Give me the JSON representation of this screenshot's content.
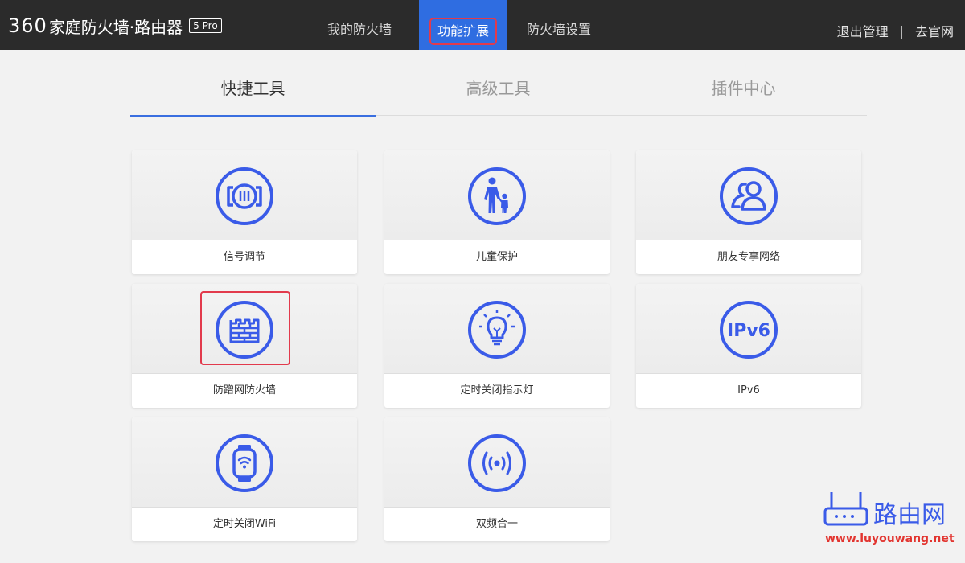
{
  "header": {
    "logo_number": "360",
    "logo_text": "家庭防火墙·路由器",
    "logo_badge": "5 Pro",
    "nav": [
      {
        "label": "我的防火墙",
        "active": false
      },
      {
        "label": "功能扩展",
        "active": true
      },
      {
        "label": "防火墙设置",
        "active": false
      }
    ],
    "logout_label": "退出管理",
    "separator": "|",
    "website_label": "去官网"
  },
  "tabs": [
    {
      "label": "快捷工具",
      "active": true
    },
    {
      "label": "高级工具",
      "active": false
    },
    {
      "label": "插件中心",
      "active": false
    }
  ],
  "tools": [
    {
      "label": "信号调节",
      "icon": "signal-adjust-icon"
    },
    {
      "label": "儿童保护",
      "icon": "child-protection-icon"
    },
    {
      "label": "朋友专享网络",
      "icon": "friends-network-icon"
    },
    {
      "label": "防蹭网防火墙",
      "icon": "firewall-wall-icon",
      "highlighted": true
    },
    {
      "label": "定时关闭指示灯",
      "icon": "light-bulb-icon"
    },
    {
      "label": "IPv6",
      "icon": "ipv6-icon",
      "icon_text": "IPv6"
    },
    {
      "label": "定时关闭WiFi",
      "icon": "wifi-watch-icon"
    },
    {
      "label": "双频合一",
      "icon": "dual-band-icon"
    }
  ],
  "colors": {
    "topbar": "#2b2b2b",
    "accent": "#2f6de1",
    "icon_blue": "#3a5be8",
    "highlight_red": "#e23a4c",
    "background": "#f2f2f2"
  },
  "watermark": {
    "text": "路由网",
    "url": "www.luyouwang.net"
  }
}
